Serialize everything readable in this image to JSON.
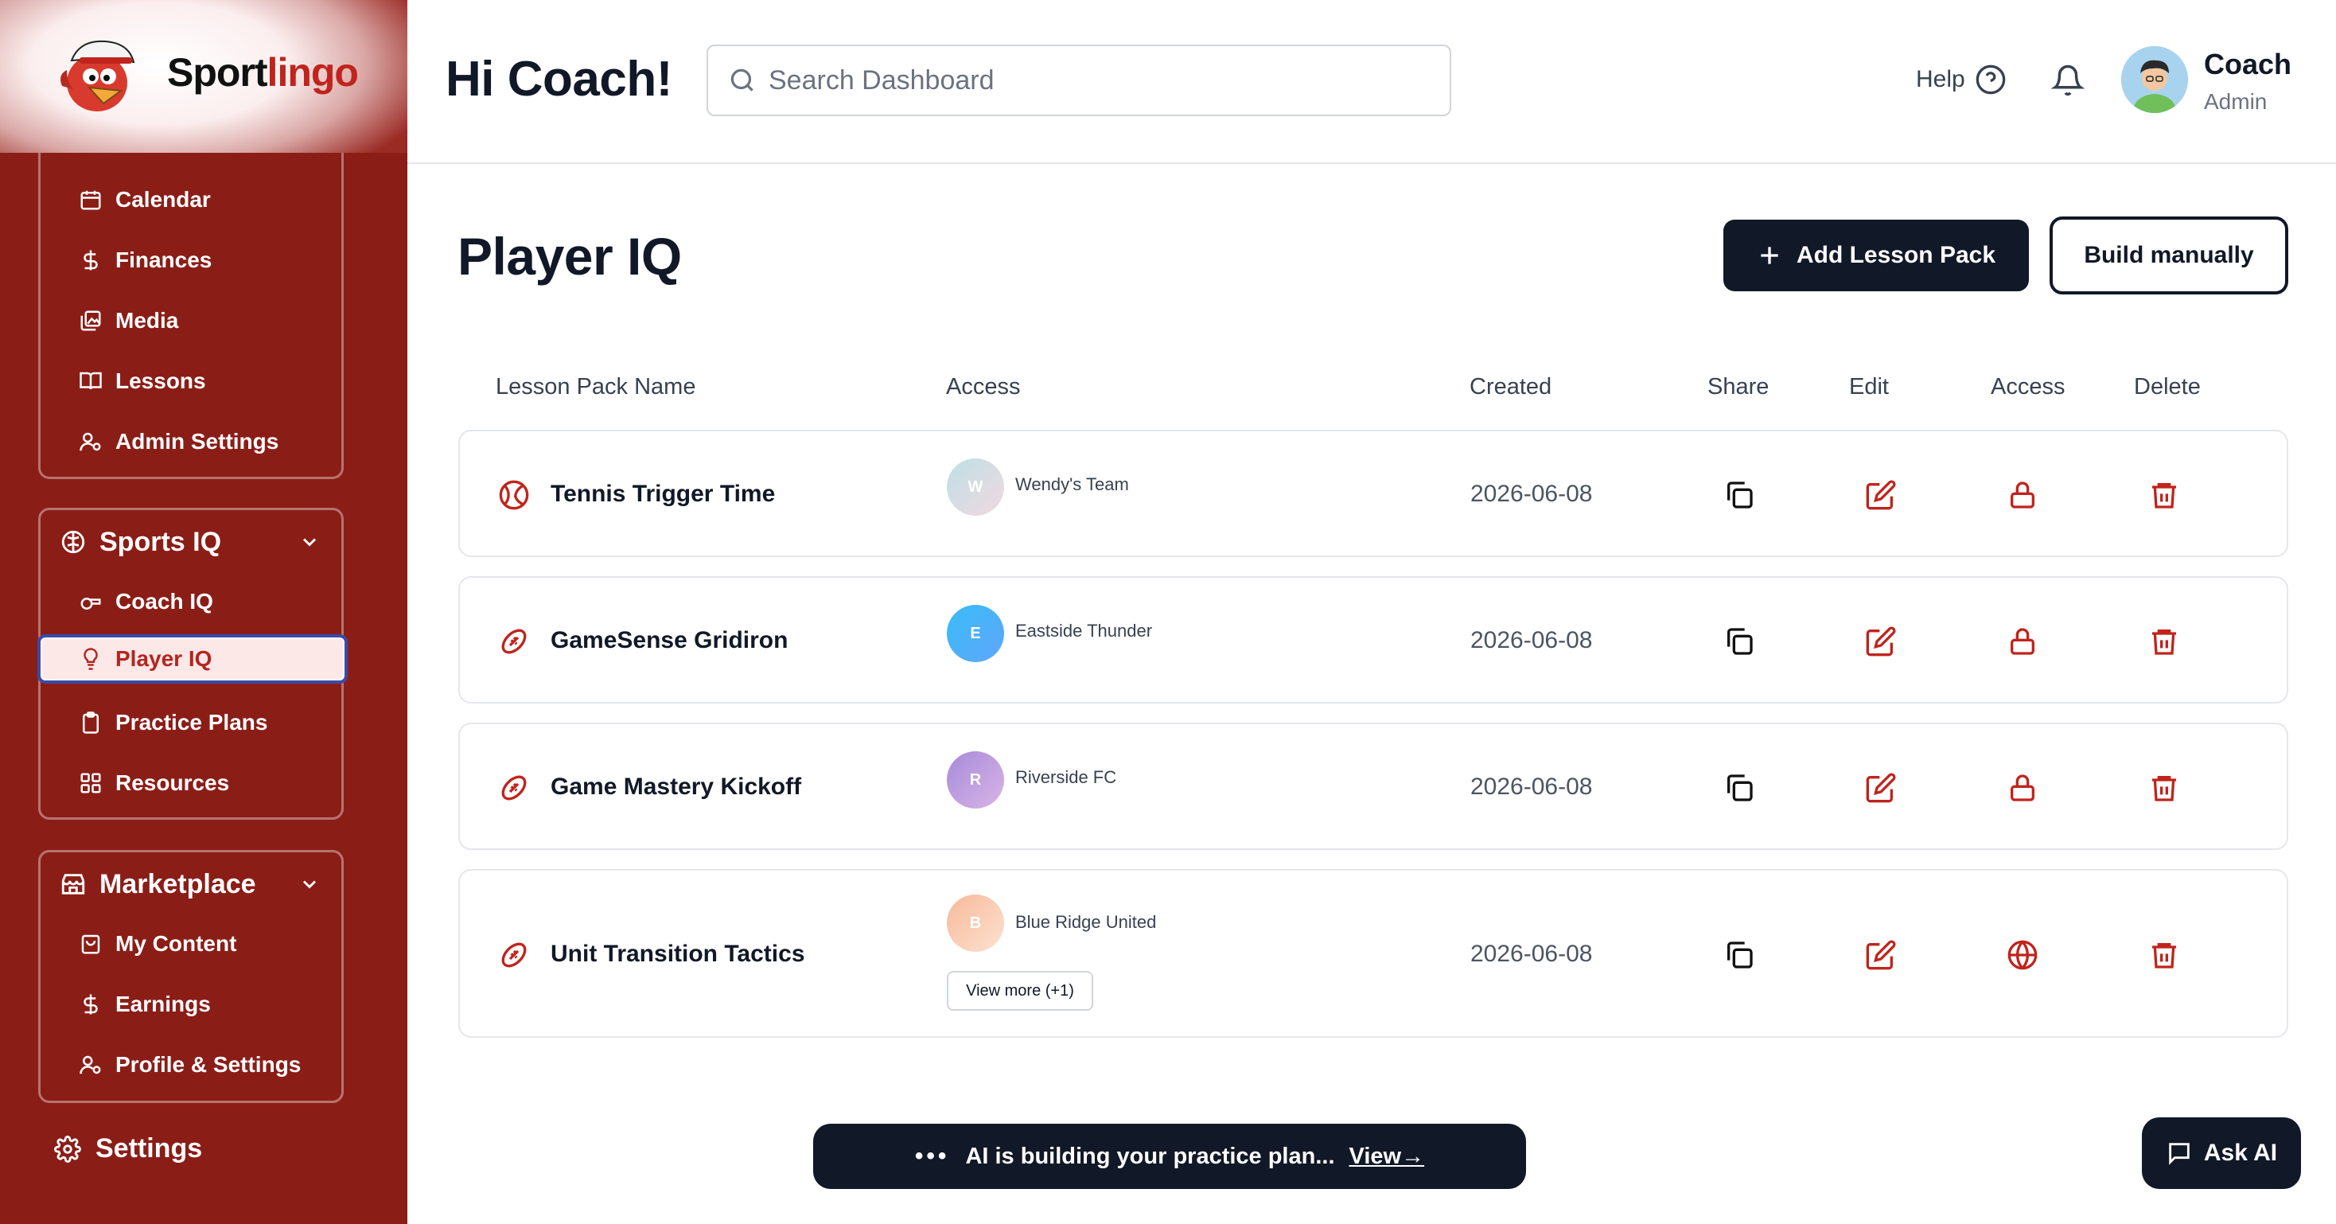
{
  "app": {
    "brand_part1": "Sport",
    "brand_part2": "lingo"
  },
  "sidebar": {
    "group1": [
      "Calendar",
      "Finances",
      "Media",
      "Lessons",
      "Admin Settings"
    ],
    "sports_iq": {
      "title": "Sports IQ",
      "items": [
        "Coach IQ",
        "Player IQ",
        "Practice Plans",
        "Resources"
      ],
      "active": "Player IQ"
    },
    "marketplace": {
      "title": "Marketplace",
      "items": [
        "My Content",
        "Earnings",
        "Profile & Settings"
      ]
    },
    "settings": "Settings"
  },
  "header": {
    "greeting": "Hi Coach!",
    "search_placeholder": "Search Dashboard",
    "help": "Help",
    "user": {
      "name": "Coach",
      "role": "Admin"
    }
  },
  "main": {
    "title": "Player IQ",
    "add_button": "Add Lesson Pack",
    "build_button": "Build manually",
    "columns": [
      "Lesson Pack Name",
      "Access",
      "Created",
      "Share",
      "Edit",
      "Access",
      "Delete"
    ],
    "rows": [
      {
        "name": "Tennis Trigger Time",
        "icon": "tennis-ball-icon",
        "team": "Wendy's Team",
        "initial": "W",
        "created": "2026-06-08",
        "access_icon": "lock-icon"
      },
      {
        "name": "GameSense Gridiron",
        "icon": "football-icon",
        "team": "Eastside Thunder",
        "initial": "E",
        "created": "2026-06-08",
        "access_icon": "lock-icon"
      },
      {
        "name": "Game Mastery Kickoff",
        "icon": "football-icon",
        "team": "Riverside FC",
        "initial": "R",
        "created": "2026-06-08",
        "access_icon": "lock-icon"
      },
      {
        "name": "Unit Transition Tactics",
        "icon": "football-icon",
        "team": "Blue Ridge United",
        "initial": "B",
        "created": "2026-06-08",
        "access_icon": "globe-icon",
        "view_more": "View more (+1)"
      }
    ]
  },
  "ai_banner": {
    "dots": "•••",
    "text": "AI is building your practice plan...",
    "link": "View→"
  },
  "ask_ai": "Ask AI",
  "colors": {
    "sidebar": "#8b1d17",
    "accent": "#c0241c",
    "dark": "#111827",
    "active_bg": "#fde8e8"
  }
}
